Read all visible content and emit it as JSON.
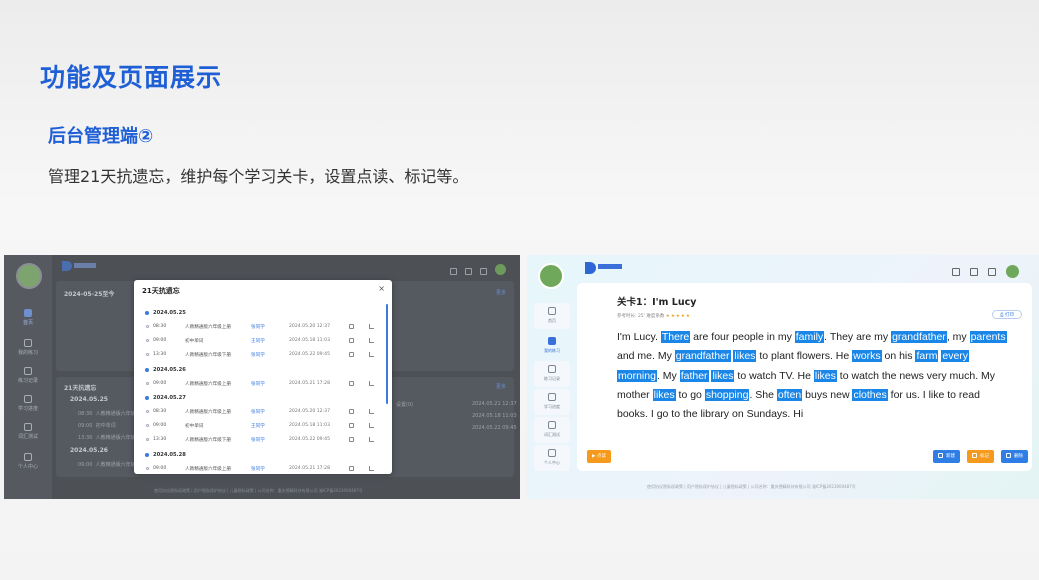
{
  "slide": {
    "title": "功能及页面展示",
    "subtitle": "后台管理端②",
    "description": "管理21天抗遗忘，维护每个学习关卡，设置点读、标记等。"
  },
  "left_screen": {
    "background": {
      "date_range": "2024-05-25至今",
      "link_more": "更多",
      "section_title": "21天抗遗忘",
      "link_more2": "更多",
      "date_label": "2024.05.25",
      "date_label2": "2024.05.26",
      "rows": [
        {
          "time": "08:30",
          "book": "人教精通版六年级上册"
        },
        {
          "time": "09:00",
          "book": "初中单词"
        },
        {
          "time": "13:30",
          "book": "人教精通版六年级下册"
        },
        {
          "time": "09:00",
          "book": "人教精通版六年级上册"
        }
      ],
      "right_values": [
        "2024.05.21 12:37",
        "2024.05.18 11:03",
        "2024.05.22 09:45"
      ],
      "mid_value": "设置(0)"
    },
    "nav": [
      "首页",
      "我的练习",
      "练习记录",
      "学习进度",
      "词汇测试",
      "个人中心"
    ],
    "footer": "使用协议隐私权政策  |  用户隐私保护协议  |  儿童隐私政策  |  公司名称：重庆德精科技有限公司  渝ICP备2023000487号",
    "modal": {
      "title": "21天抗遗忘",
      "close": "×",
      "groups": [
        {
          "date": "2024.05.25",
          "rows": [
            {
              "time": "08:30",
              "book": "人教精通版六年级上册",
              "user": "张同学",
              "ts": "2024.05.20 12:37"
            },
            {
              "time": "09:00",
              "book": "初中单词",
              "user": "王同学",
              "ts": "2024.05.18 11:03"
            },
            {
              "time": "13:30",
              "book": "人教精通版六年级下册",
              "user": "张同学",
              "ts": "2024.05.22 09:45"
            }
          ]
        },
        {
          "date": "2024.05.26",
          "rows": [
            {
              "time": "09:00",
              "book": "人教精通版六年级上册",
              "user": "张同学",
              "ts": "2024.05.21 17:28"
            }
          ]
        },
        {
          "date": "2024.05.27",
          "rows": [
            {
              "time": "08:30",
              "book": "人教精通版六年级上册",
              "user": "张同学",
              "ts": "2024.05.20 12:37"
            },
            {
              "time": "09:00",
              "book": "初中单词",
              "user": "王同学",
              "ts": "2024.05.18 11:03"
            },
            {
              "time": "13:30",
              "book": "人教精通版六年级下册",
              "user": "张同学",
              "ts": "2024.05.22 09:45"
            }
          ]
        },
        {
          "date": "2024.05.28",
          "rows": [
            {
              "time": "09:00",
              "book": "人教精通版六年级上册",
              "user": "张同学",
              "ts": "2024.05.21 17:28"
            }
          ]
        }
      ]
    }
  },
  "right_screen": {
    "nav": [
      "首页",
      "我的练习",
      "练习记录",
      "学习进度",
      "词汇测试",
      "个人中心"
    ],
    "card": {
      "title": "关卡1：I'm Lucy",
      "meta": "参考时长: 25' 难度系数",
      "stars": "★★★★★",
      "print_label": "打印",
      "passage": [
        {
          "t": "I'm Lucy. "
        },
        {
          "t": "There",
          "h": true
        },
        {
          "t": " are four people in my "
        },
        {
          "t": "family",
          "h": true
        },
        {
          "t": ". They are my "
        },
        {
          "t": "grandfather",
          "h": true
        },
        {
          "t": ", my "
        },
        {
          "t": "parents",
          "h": true
        },
        {
          "t": " and me. My "
        },
        {
          "t": "grandfather",
          "h": true
        },
        {
          "t": " "
        },
        {
          "t": "likes",
          "h": true
        },
        {
          "t": " to plant flowers. He "
        },
        {
          "t": "works",
          "h": true
        },
        {
          "t": " on his "
        },
        {
          "t": "farm",
          "h": true
        },
        {
          "t": " "
        },
        {
          "t": "every",
          "h": true
        },
        {
          "t": " "
        },
        {
          "t": "morning",
          "h": true
        },
        {
          "t": ". My "
        },
        {
          "t": "father",
          "h": true
        },
        {
          "t": " "
        },
        {
          "t": "likes",
          "h": true
        },
        {
          "t": " to watch TV. He "
        },
        {
          "t": "likes",
          "h": true
        },
        {
          "t": " to watch the news very much. My mother "
        },
        {
          "t": "likes",
          "h": true
        },
        {
          "t": " to go "
        },
        {
          "t": "shopping",
          "h": true
        },
        {
          "t": ". She "
        },
        {
          "t": "often",
          "h": true
        },
        {
          "t": " buys new "
        },
        {
          "t": "clothes",
          "h": true
        },
        {
          "t": " for us. I like to read books. I go to the library on Sundays. Hi"
        }
      ],
      "play_label": "点读",
      "buttons": [
        "新建",
        "标记",
        "删除"
      ]
    },
    "footer": "使用协议隐私权政策  |  用户隐私保护协议  |  儿童隐私政策  |  公司名称：重庆德精科技有限公司  渝ICP备2023000487号"
  },
  "colors": {
    "accent": "#1f5fd6",
    "highlight": "#1a86e8",
    "play_button": "#f59a1c",
    "mark_button": "#f59a1c",
    "blue_button": "#2f7ee6"
  }
}
